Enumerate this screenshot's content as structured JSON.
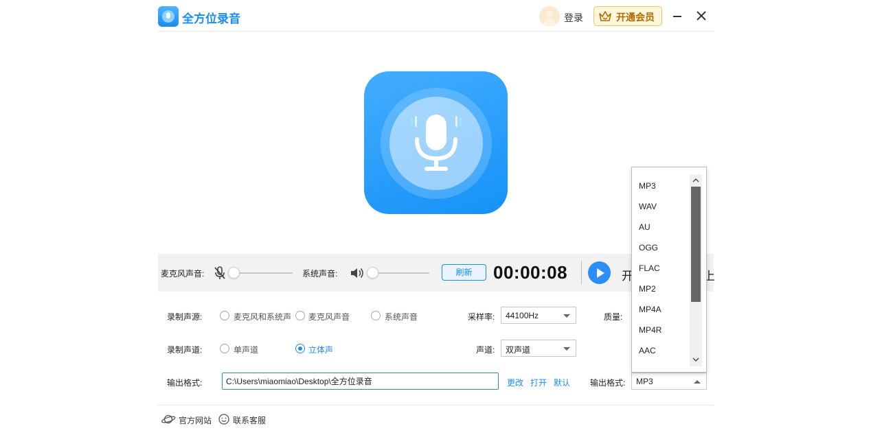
{
  "app": {
    "title": "全方位录音"
  },
  "header": {
    "login_label": "登录",
    "vip_label": "开通会员"
  },
  "colors": {
    "accent": "#1a8cf5",
    "vip_border": "#f0c070",
    "vip_text": "#b06a00"
  },
  "control": {
    "mic_label": "麦克风声音:",
    "system_label": "系统声音:",
    "refresh_label": "刷新",
    "timer": "00:00:08",
    "start_label": "开",
    "end_char": "上",
    "mic_level": 0,
    "system_level": 0
  },
  "settings": {
    "source_label": "录制声源:",
    "source_options": [
      "麦克风和系统声",
      "麦克风声音",
      "系统声音"
    ],
    "channel_label": "录制声道:",
    "channel_options": [
      "单声道",
      "立体声"
    ],
    "channel_selected": "立体声",
    "samplerate_label": "采样率:",
    "samplerate_value": "44100Hz",
    "quality_label": "质量:",
    "track_label": "声道:",
    "track_value": "双声道",
    "output_label": "输出格式:",
    "output_path": "C:\\Users\\miaomiao\\Desktop\\全方位录音",
    "change_label": "更改",
    "open_label": "打开",
    "default_label": "默认",
    "format_label": "输出格式:",
    "format_value": "MP3"
  },
  "dropdown": {
    "items": [
      "MP3",
      "WAV",
      "AU",
      "OGG",
      "FLAC",
      "MP2",
      "MP4A",
      "MP4R",
      "AAC"
    ]
  },
  "footer": {
    "website_label": "官方网站",
    "support_label": "联系客服"
  }
}
